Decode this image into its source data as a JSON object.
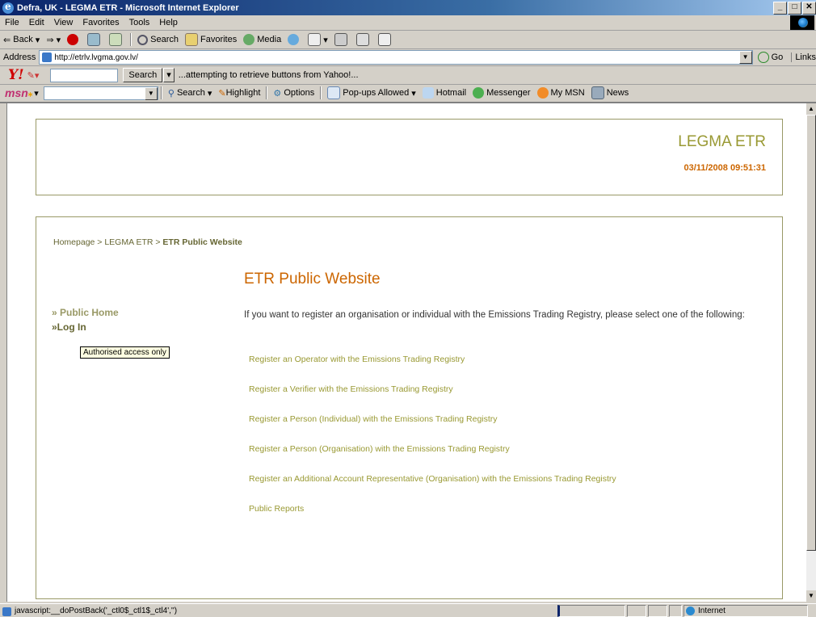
{
  "window": {
    "title": "Defra, UK - LEGMA ETR - Microsoft Internet Explorer",
    "min_label": "_",
    "max_label": "□",
    "close_label": "✕"
  },
  "menu": [
    "File",
    "Edit",
    "View",
    "Favorites",
    "Tools",
    "Help"
  ],
  "toolbar": {
    "back": "Back",
    "search": "Search",
    "favorites": "Favorites",
    "media": "Media"
  },
  "address": {
    "label": "Address",
    "url": "http://etrlv.lvgma.gov.lv/",
    "go": "Go",
    "links": "Links"
  },
  "yahoo": {
    "logo": "Y!",
    "search_button": "Search",
    "status": "...attempting to retrieve buttons from Yahoo!..."
  },
  "msn": {
    "logo": "msn",
    "search": "Search",
    "highlight": "Highlight",
    "options": "Options",
    "popups": "Pop-ups Allowed",
    "hotmail": "Hotmail",
    "messenger": "Messenger",
    "mymsn": "My MSN",
    "news": "News"
  },
  "page": {
    "site_name": "LEGMA ETR",
    "datetime": "03/11/2008 09:51:31",
    "breadcrumb": {
      "home": "Homepage",
      "sep1": " > ",
      "section": "LEGMA ETR",
      "sep2": " > ",
      "current": "ETR Public Website"
    },
    "title": "ETR Public Website",
    "nav": {
      "public_home": "» Public Home",
      "login": "»Log In",
      "tooltip": "Authorised access only"
    },
    "intro": "If you want to register an organisation or individual with the Emissions Trading Registry, please select one of the following:",
    "links": [
      "Register an Operator with the Emissions Trading Registry",
      "Register a Verifier with the Emissions Trading Registry",
      "Register a Person (Individual) with the Emissions Trading Registry",
      "Register a Person (Organisation) with the Emissions Trading Registry",
      "Register an Additional Account Representative (Organisation) with the Emissions Trading Registry",
      "Public Reports"
    ]
  },
  "status": {
    "message": "javascript:__doPostBack('_ctl0$_ctl1$_ctl4','')",
    "zone": "Internet"
  }
}
